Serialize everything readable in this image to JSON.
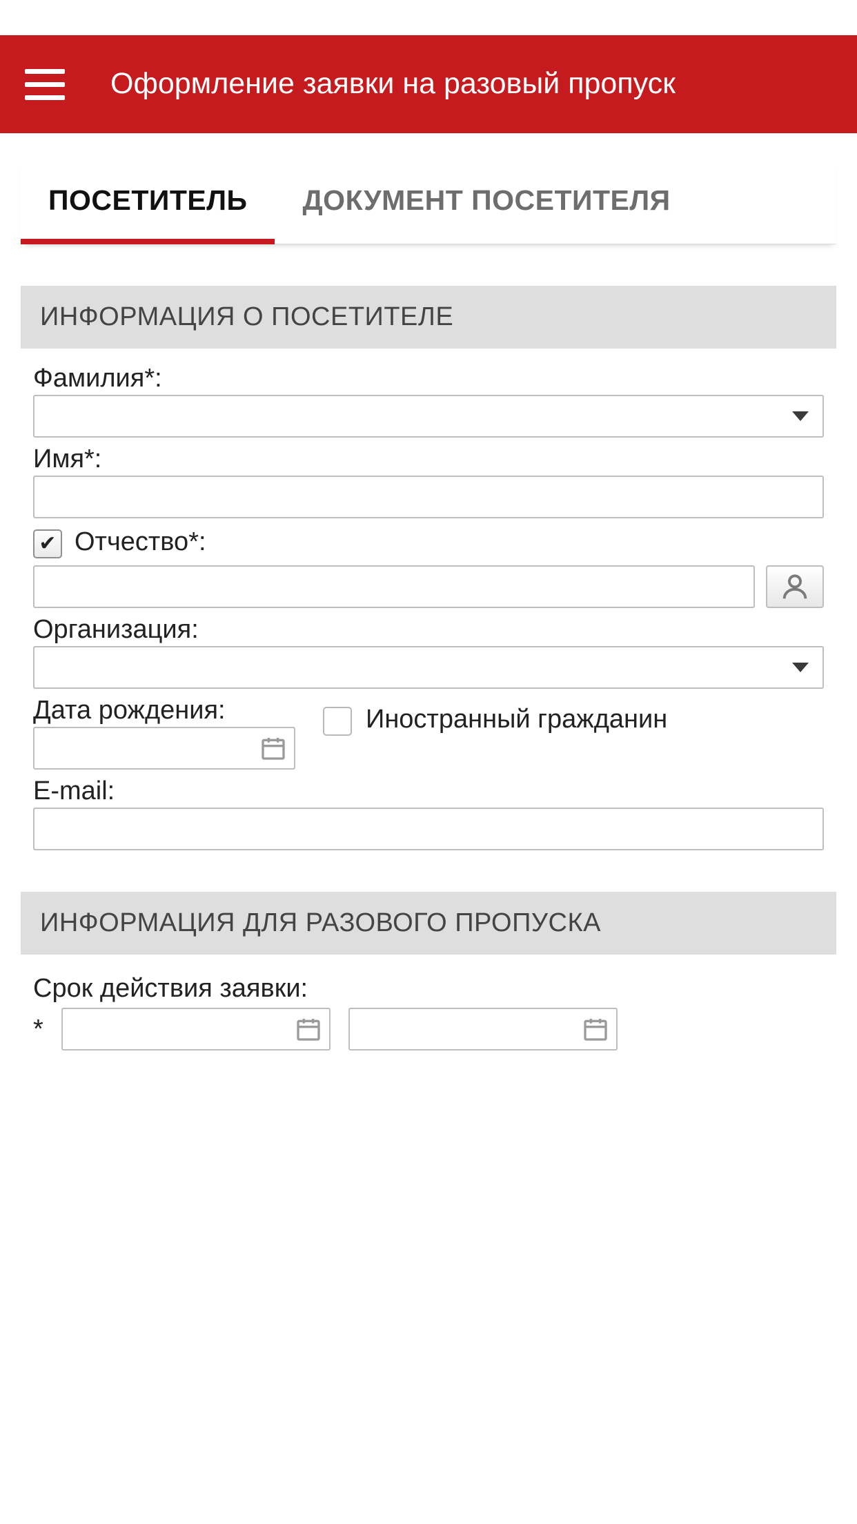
{
  "header": {
    "title": "Оформление заявки на разовый пропуск"
  },
  "tabs": {
    "visitor": "ПОСЕТИТЕЛЬ",
    "document": "ДОКУМЕНТ ПОСЕТИТЕЛЯ"
  },
  "section1": {
    "title": "ИНФОРМАЦИЯ О ПОСЕТИТЕЛЕ",
    "lastname_label": "Фамилия*:",
    "firstname_label": "Имя*:",
    "patronymic_label": "Отчество*:",
    "organization_label": "Организация:",
    "dob_label": "Дата рождения:",
    "foreign_label": "Иностранный гражданин",
    "email_label": "E-mail:"
  },
  "section2": {
    "title": "ИНФОРМАЦИЯ ДЛЯ РАЗОВОГО ПРОПУСКА",
    "validity_label": "Срок действия заявки:"
  }
}
